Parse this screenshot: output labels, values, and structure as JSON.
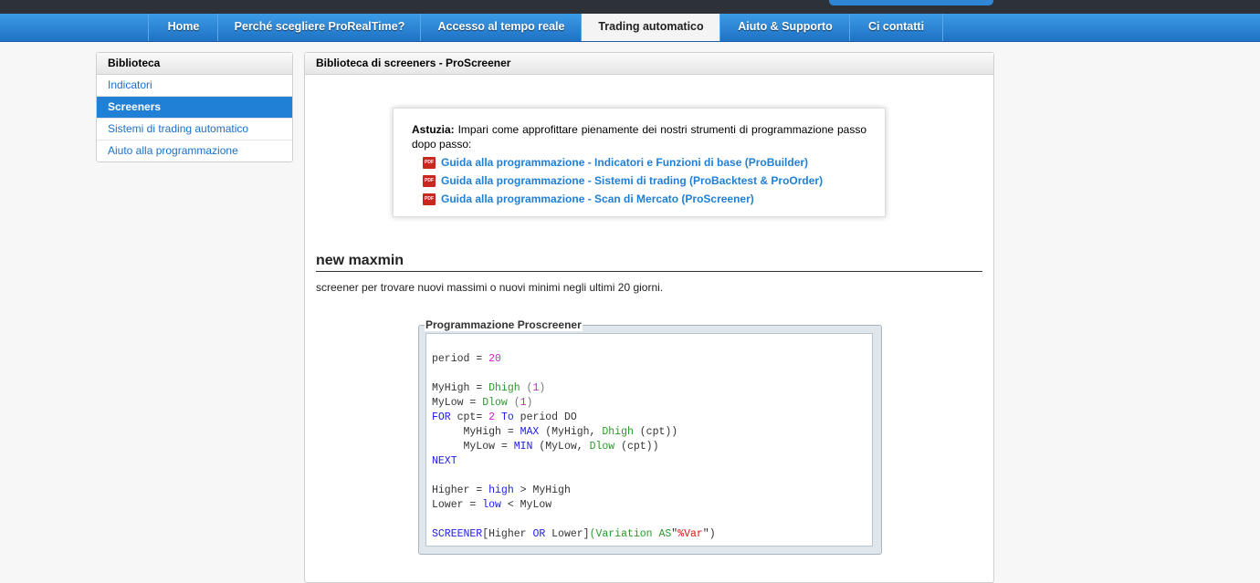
{
  "nav": {
    "items": [
      "Home",
      "Perché scegliere ProRealTime?",
      "Accesso al tempo reale",
      "Trading automatico",
      "Aiuto & Supporto",
      "Ci contatti"
    ],
    "active": 3
  },
  "sidebar": {
    "title": "Biblioteca",
    "items": [
      "Indicatori",
      "Screeners",
      "Sistemi di trading automatico",
      "Aiuto alla programmazione"
    ],
    "active": 1
  },
  "main": {
    "header": "Biblioteca di screeners - ProScreener",
    "tip": {
      "label": "Astuzia:",
      "text": "Impari come approfittare pienamente dei nostri strumenti di programmazione passo dopo passo:",
      "pdf_icon": "PDF",
      "links": [
        "Guida alla programmazione - Indicatori e Funzioni di base (ProBuilder)",
        "Guida alla programmazione - Sistemi di trading (ProBacktest & ProOrder)",
        "Guida alla programmazione - Scan di Mercato (ProScreener)"
      ]
    },
    "title": "new maxmin",
    "description": "screener per trovare nuovi massimi o nuovi minimi negli ultimi 20 giorni.",
    "code_legend": "Programmazione Proscreener",
    "code": [
      [
        [
          "",
          "period = "
        ],
        [
          "n",
          "20"
        ]
      ],
      [],
      [
        [
          "",
          "MyHigh = "
        ],
        [
          "f",
          "Dhigh"
        ],
        [
          "p",
          " ("
        ],
        [
          "n",
          "1"
        ],
        [
          "p",
          ")"
        ]
      ],
      [
        [
          "",
          "MyLow = "
        ],
        [
          "f",
          "Dlow"
        ],
        [
          "p",
          " ("
        ],
        [
          "n",
          "1"
        ],
        [
          "p",
          ")"
        ]
      ],
      [
        [
          "k",
          "FOR"
        ],
        [
          "",
          " cpt= "
        ],
        [
          "n",
          "2"
        ],
        [
          "k",
          " To"
        ],
        [
          "",
          " period DO"
        ]
      ],
      [
        [
          "",
          "     MyHigh = "
        ],
        [
          "k",
          "MAX"
        ],
        [
          "",
          " (MyHigh, "
        ],
        [
          "f",
          "Dhigh"
        ],
        [
          "",
          " (cpt))"
        ]
      ],
      [
        [
          "",
          "     MyLow = "
        ],
        [
          "k",
          "MIN"
        ],
        [
          "",
          " (MyLow, "
        ],
        [
          "f",
          "Dlow"
        ],
        [
          "",
          " (cpt))"
        ]
      ],
      [
        [
          "k",
          "NEXT"
        ]
      ],
      [],
      [
        [
          "",
          "Higher = "
        ],
        [
          "k",
          "high"
        ],
        [
          "",
          " > MyHigh"
        ]
      ],
      [
        [
          "",
          "Lower = "
        ],
        [
          "k",
          "low"
        ],
        [
          "",
          " < MyLow"
        ]
      ],
      [],
      [
        [
          "k",
          "SCREENER"
        ],
        [
          "",
          "[Higher "
        ],
        [
          "k",
          "OR"
        ],
        [
          "",
          " Lower]"
        ],
        [
          "f",
          "(Variation AS"
        ],
        [
          "",
          "\""
        ],
        [
          "s",
          "%Var"
        ],
        [
          "",
          "\")"
        ]
      ]
    ]
  }
}
